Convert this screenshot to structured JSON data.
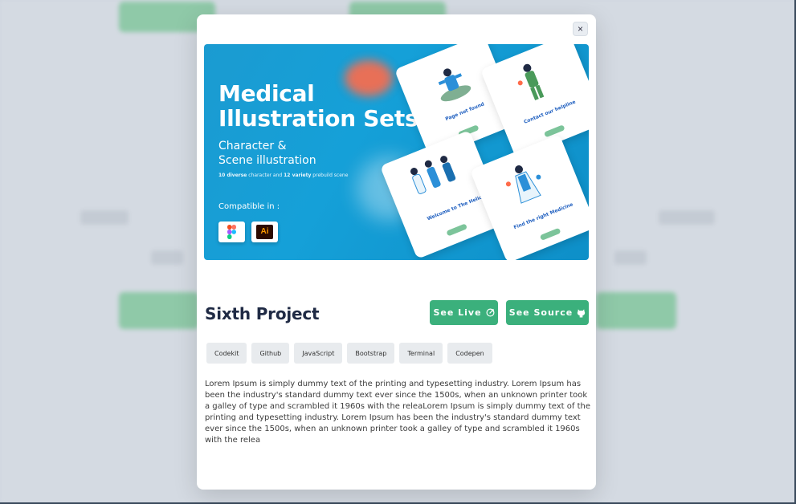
{
  "modal": {
    "close_label": "×",
    "banner": {
      "title_line1": "Medical",
      "title_line2": "Illustration Sets",
      "subtitle_line1": "Character &",
      "subtitle_line2": "Scene illustration",
      "small_bold1": "10 diverse",
      "small_mid": " character and ",
      "small_bold2": "12 variety",
      "small_end": " prebuild scene",
      "compatible": "Compatible in :",
      "tool_ai": "Ai",
      "screens": [
        {
          "label": "Page not found"
        },
        {
          "label": "Contact our helpline"
        },
        {
          "label": "Welcome to The Helios Medical"
        },
        {
          "label": "Find the right Medicine"
        }
      ]
    },
    "project_title": "Sixth Project",
    "see_live_label": "See Live",
    "see_source_label": "See Source",
    "tags": [
      "Codekit",
      "Github",
      "JavaScript",
      "Bootstrap",
      "Terminal",
      "Codepen"
    ],
    "description": "Lorem Ipsum is simply dummy text of the printing and typesetting industry. Lorem Ipsum has been the industry's standard dummy text ever since the 1500s, when an unknown printer took a galley of type and scrambled it 1960s with the releaLorem Ipsum is simply dummy text of the printing and typesetting industry. Lorem Ipsum has been the industry's standard dummy text ever since the 1500s, when an unknown printer took a galley of type and scrambled it 1960s with the relea"
  },
  "colors": {
    "accent": "#3bb07c",
    "banner_blue": "#1b9bd1",
    "title_dark": "#1f2a44"
  },
  "icons": {
    "close": "close-icon",
    "live": "external-link-icon",
    "source": "github-icon"
  }
}
